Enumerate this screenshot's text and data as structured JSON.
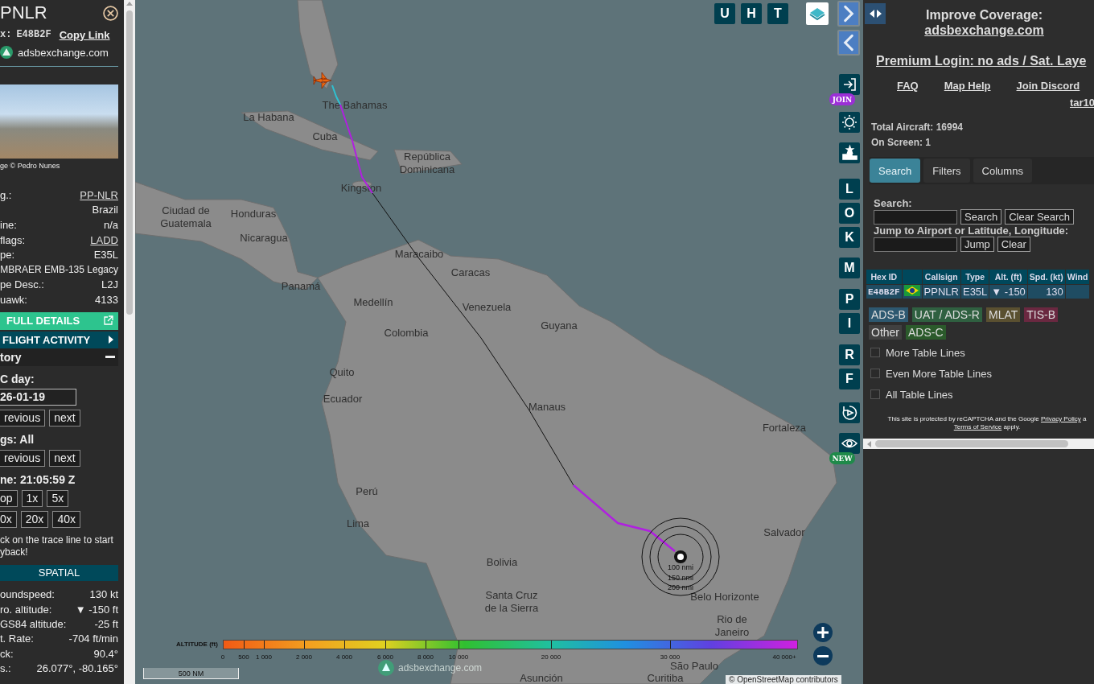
{
  "aircraft_panel": {
    "title": "PNLR",
    "hex_label": "x:",
    "hex": "E48B2F",
    "copy_link": "Copy Link",
    "source": "adsbexchange.com",
    "photo_credit": "ge © Pedro Nunes",
    "details": [
      {
        "kind": "link",
        "label": "g.:",
        "value": "PP-NLR"
      },
      {
        "kind": "value",
        "value": "Brazil"
      },
      {
        "kind": "pair",
        "label": "ine:",
        "value": "n/a"
      },
      {
        "kind": "link",
        "label": "flags:",
        "value": "LADD"
      },
      {
        "kind": "pair",
        "label": "pe:",
        "value": "E35L"
      },
      {
        "kind": "full",
        "value": "MBRAER EMB-135 Legacy"
      },
      {
        "kind": "pair",
        "label": "pe Desc.:",
        "value": "L2J"
      },
      {
        "kind": "pair",
        "label": "uawk:",
        "value": "4133"
      }
    ],
    "full_details": "FULL DETAILS",
    "flight_activity": "FLIGHT ACTIVITY",
    "history": {
      "title": "tory",
      "expanded": true,
      "day_label": "C day:",
      "date": "26-01-19",
      "day_buttons": [
        "revious",
        "next"
      ],
      "legs_label": "gs: All",
      "legs_buttons": [
        "revious",
        "next"
      ],
      "time_label": "ne: 21:05:59 Z",
      "speed_rows": [
        [
          "op",
          "1x",
          "5x"
        ],
        [
          "0x",
          "20x",
          "40x"
        ]
      ],
      "hint_lines": [
        "ck on the trace line to start",
        "yback!"
      ]
    },
    "spatial": {
      "title": "SPATIAL",
      "rows": [
        {
          "label": "oundspeed:",
          "value": "130 kt"
        },
        {
          "label": "ro. altitude:",
          "value": "▼ -150 ft"
        },
        {
          "label": "GS84 altitude:",
          "value": "-25 ft"
        },
        {
          "label": "t. Rate:",
          "value": "-704 ft/min"
        },
        {
          "label": "ck:",
          "value": "90.4°"
        },
        {
          "label": "s.:",
          "value": "26.077°, -80.165°"
        }
      ]
    }
  },
  "map": {
    "labels": [
      "The Bahamas",
      "La Habana",
      "Cuba",
      "República Dominicana",
      "Kingston",
      "Ciudad de Guatemala",
      "Honduras",
      "Nicaragua",
      "Maracaibo",
      "Caracas",
      "Panamá",
      "Medellín",
      "Venezuela",
      "Guyana",
      "Colombia",
      "Quito",
      "Ecuador",
      "Manaus",
      "Fortaleza",
      "Perú",
      "Lima",
      "Salvador",
      "Bolivia",
      "Santa Cruz de la Sierra",
      "Belo Horizonte",
      "Rio de Janeiro",
      "São Paulo",
      "Asunción",
      "Curitiba"
    ],
    "top_buttons": [
      "U",
      "H",
      "T"
    ],
    "side_controls": [
      {
        "kind": "login",
        "badge": {
          "text": "JOIN",
          "color": "#9b2fd6"
        }
      },
      {
        "kind": "gear"
      },
      {
        "kind": "podium"
      },
      {
        "kind": "letter",
        "label": "L"
      },
      {
        "kind": "letter",
        "label": "O"
      },
      {
        "kind": "letter",
        "label": "K"
      },
      {
        "kind": "letter",
        "label": "M"
      },
      {
        "kind": "letter",
        "label": "P"
      },
      {
        "kind": "letter",
        "label": "I"
      },
      {
        "kind": "letter",
        "label": "R"
      },
      {
        "kind": "letter",
        "label": "F"
      },
      {
        "kind": "replay"
      },
      {
        "kind": "eye",
        "badge": {
          "text": "NEW",
          "color": "#1f8a4a"
        }
      }
    ],
    "range_rings": [
      "100 nmi",
      "150 nmi",
      "200 nmi"
    ],
    "altitude_legend": {
      "title": "ALTITUDE (ft)",
      "ticks": [
        "0",
        "500",
        "1 000",
        "2 000",
        "4 000",
        "6 000",
        "8 000",
        "10 000",
        "20 000",
        "30 000",
        "40 000+"
      ]
    },
    "scale": "500 NM",
    "logo": "adsbexchange.com",
    "attribution": "© OpenStreetMap contributors"
  },
  "side_panel": {
    "coverage_title": "Improve Coverage:",
    "coverage_link": "adsbexchange.com",
    "premium_link": "Premium Login: no ads / Sat. Laye",
    "links": [
      "FAQ",
      "Map Help",
      "Join Discord"
    ],
    "user_link": "tar10",
    "total": "Total Aircraft: 16994",
    "on_screen": "On Screen: 1",
    "tabs": [
      {
        "label": "Search",
        "selected": true
      },
      {
        "label": "Filters",
        "selected": false
      },
      {
        "label": "Columns",
        "selected": false
      }
    ],
    "search": {
      "label": "Search:",
      "buttons": [
        "Search",
        "Clear Search"
      ],
      "jump_label": "Jump to Airport or Latitude, Longitude:",
      "jump_buttons": [
        "Jump",
        "Clear"
      ]
    },
    "table": {
      "columns": [
        {
          "kind": "text",
          "label": "Hex ID"
        },
        {
          "kind": "flag"
        },
        {
          "kind": "text",
          "label": "Callsign"
        },
        {
          "kind": "text",
          "label": "Type"
        },
        {
          "kind": "text",
          "label": "Alt. (ft)"
        },
        {
          "kind": "text",
          "label": "Spd. (kt)"
        },
        {
          "kind": "text",
          "label": "Wind"
        }
      ],
      "rows": [
        {
          "hex": "E48B2F",
          "callsign": "PPNLR",
          "type": "E35L",
          "altitude": "▼ -150",
          "speed": "130"
        }
      ]
    },
    "source_tags": [
      {
        "label": "ADS-B",
        "color": "#2d5870"
      },
      {
        "label": "UAT / ADS-R",
        "color": "#2f6040"
      },
      {
        "label": "MLAT",
        "color": "#5a5030"
      },
      {
        "label": "TIS-B",
        "color": "#6a2840"
      },
      {
        "label": "Other",
        "color": "#404040"
      },
      {
        "label": "ADS-C",
        "color": "#2b5a2b"
      }
    ],
    "options": [
      {
        "label": "More Table Lines",
        "checked": false
      },
      {
        "label": "Even More Table Lines",
        "checked": false
      },
      {
        "label": "All Table Lines",
        "checked": false
      }
    ],
    "recaptcha": {
      "text": "This site is protected by reCAPTCHA and the Google",
      "privacy": "Privacy Policy",
      "tail": "a",
      "terms": "Terms of Service",
      "apply": "apply."
    }
  }
}
